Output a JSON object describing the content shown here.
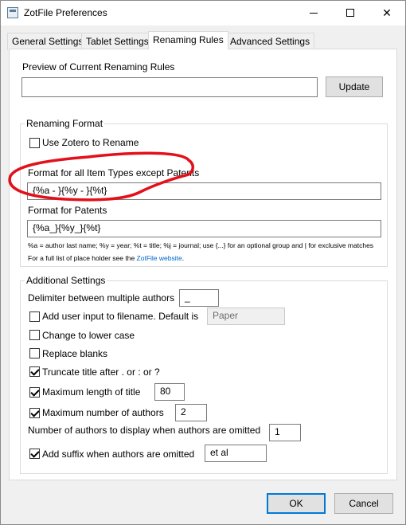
{
  "window": {
    "title": "ZotFile Preferences"
  },
  "tabs": [
    {
      "label": "General Settings"
    },
    {
      "label": "Tablet Settings"
    },
    {
      "label": "Renaming Rules"
    },
    {
      "label": "Advanced Settings"
    }
  ],
  "preview": {
    "label": "Preview of Current Renaming Rules",
    "value": "",
    "update_label": "Update"
  },
  "renaming_format": {
    "title": "Renaming Format",
    "use_zotero_label": "Use Zotero to Rename",
    "use_zotero_checked": false,
    "format_all_label": "Format for all Item Types except Patents",
    "format_all_value": "{%a - }{%y - }{%t}",
    "format_patents_label": "Format for Patents",
    "format_patents_value": "{%a_}{%y_}{%t}",
    "help_line1": "%a = author last name; %y = year; %t = title; %j = journal; use {...} for an optional group and | for exclusive matches",
    "help_line2_prefix": "For a full list of place holder see the ",
    "help_line2_link": "ZotFile website",
    "help_line2_suffix": "."
  },
  "additional": {
    "title": "Additional Settings",
    "delimiter_label": "Delimiter between multiple authors",
    "delimiter_value": "_",
    "user_input_label": "Add user input to filename. Default is",
    "user_input_checked": false,
    "user_input_value": "Paper",
    "lower_case_label": "Change to lower case",
    "lower_case_checked": false,
    "replace_blanks_label": "Replace blanks",
    "replace_blanks_checked": false,
    "truncate_label": "Truncate title after . or : or ?",
    "truncate_checked": true,
    "max_title_label": "Maximum length of title",
    "max_title_checked": true,
    "max_title_value": "80",
    "max_authors_label": "Maximum number of authors",
    "max_authors_checked": true,
    "max_authors_value": "2",
    "authors_display_label": "Number of authors to display when authors are omitted",
    "authors_display_value": "1",
    "suffix_label": "Add suffix when authors are omitted",
    "suffix_checked": true,
    "suffix_value": "et al"
  },
  "buttons": {
    "ok": "OK",
    "cancel": "Cancel"
  },
  "colors": {
    "annotation": "#e3101b",
    "link": "#0066cc",
    "accent": "#0078d7"
  }
}
